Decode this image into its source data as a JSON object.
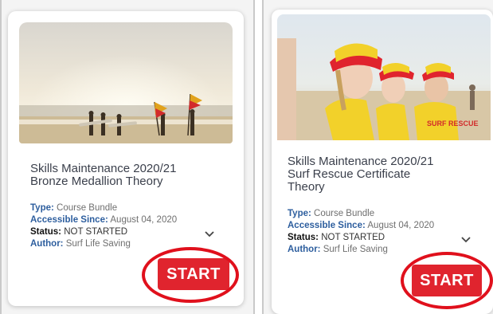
{
  "colors": {
    "accent_red": "#e0242e",
    "highlight_ring": "#e0101c",
    "meta_key_blue": "#2d5e9e",
    "title_text": "#3a3f4b"
  },
  "cards": [
    {
      "title_lines": [
        "Skills Maintenance 2020/21",
        "Bronze Medallion Theory"
      ],
      "meta": {
        "type_label": "Type:",
        "type_value": "Course Bundle",
        "since_label": "Accessible Since:",
        "since_value": "August 04, 2020",
        "status_label": "Status:",
        "status_value": "NOT STARTED",
        "author_label": "Author:",
        "author_value": "Surf Life Saving"
      },
      "start_label": "START",
      "icons": {
        "expand": "chevron-down-icon"
      }
    },
    {
      "title_lines": [
        "Skills Maintenance 2020/21",
        "Surf Rescue Certificate",
        "Theory"
      ],
      "meta": {
        "type_label": "Type:",
        "type_value": "Course Bundle",
        "since_label": "Accessible Since:",
        "since_value": "August 04, 2020",
        "status_label": "Status:",
        "status_value": "NOT STARTED",
        "author_label": "Author:",
        "author_value": "Surf Life Saving"
      },
      "start_label": "START",
      "icons": {
        "expand": "chevron-down-icon"
      }
    }
  ]
}
